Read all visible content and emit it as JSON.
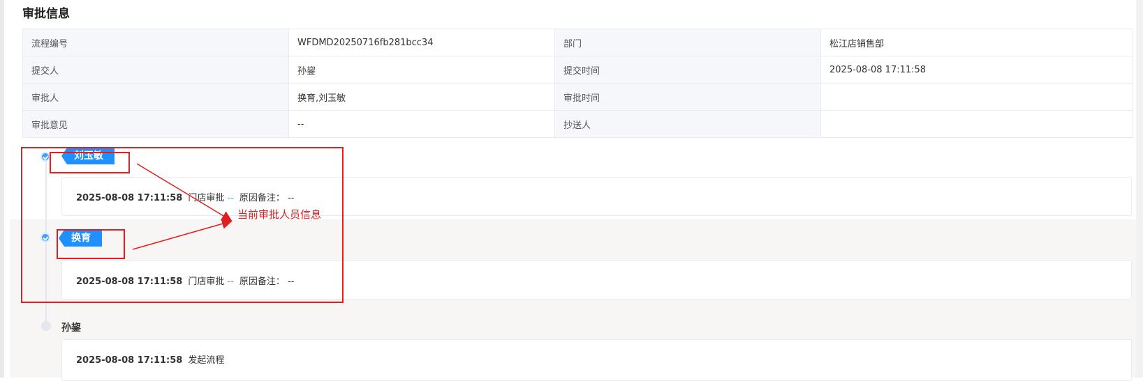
{
  "section": {
    "title": "审批信息"
  },
  "info": {
    "rows": [
      {
        "l1": "流程编号",
        "v1": "WFDMD20250716fb281bcc34",
        "l2": "部门",
        "v2": "松江店销售部"
      },
      {
        "l1": "提交人",
        "v1": "孙鋆",
        "l2": "提交时间",
        "v2": "2025-08-08 17:11:58"
      },
      {
        "l1": "审批人",
        "v1": "换育,刘玉敏",
        "l2": "审批时间",
        "v2": ""
      },
      {
        "l1": "审批意见",
        "v1": "--",
        "l2": "抄送人",
        "v2": ""
      }
    ]
  },
  "timeline": {
    "items": [
      {
        "name": "刘玉敏",
        "time": "2025-08-08 17:11:58",
        "action": "门店审批",
        "dash": "--",
        "remark_label": "原因备注：",
        "remark": "--",
        "status": "done"
      },
      {
        "name": "换育",
        "time": "2025-08-08 17:11:58",
        "action": "门店审批",
        "dash": "--",
        "remark_label": "原因备注：",
        "remark": "--",
        "status": "done"
      },
      {
        "name": "孙鋆",
        "time": "2025-08-08 17:11:58",
        "action": "发起流程",
        "status": "pending"
      }
    ]
  },
  "annotation": {
    "text": "当前审批人员信息",
    "color": "#e02020"
  },
  "colors": {
    "accent": "#1e90ff",
    "done_dot": "#409eff",
    "annotation_red": "#e02020"
  }
}
